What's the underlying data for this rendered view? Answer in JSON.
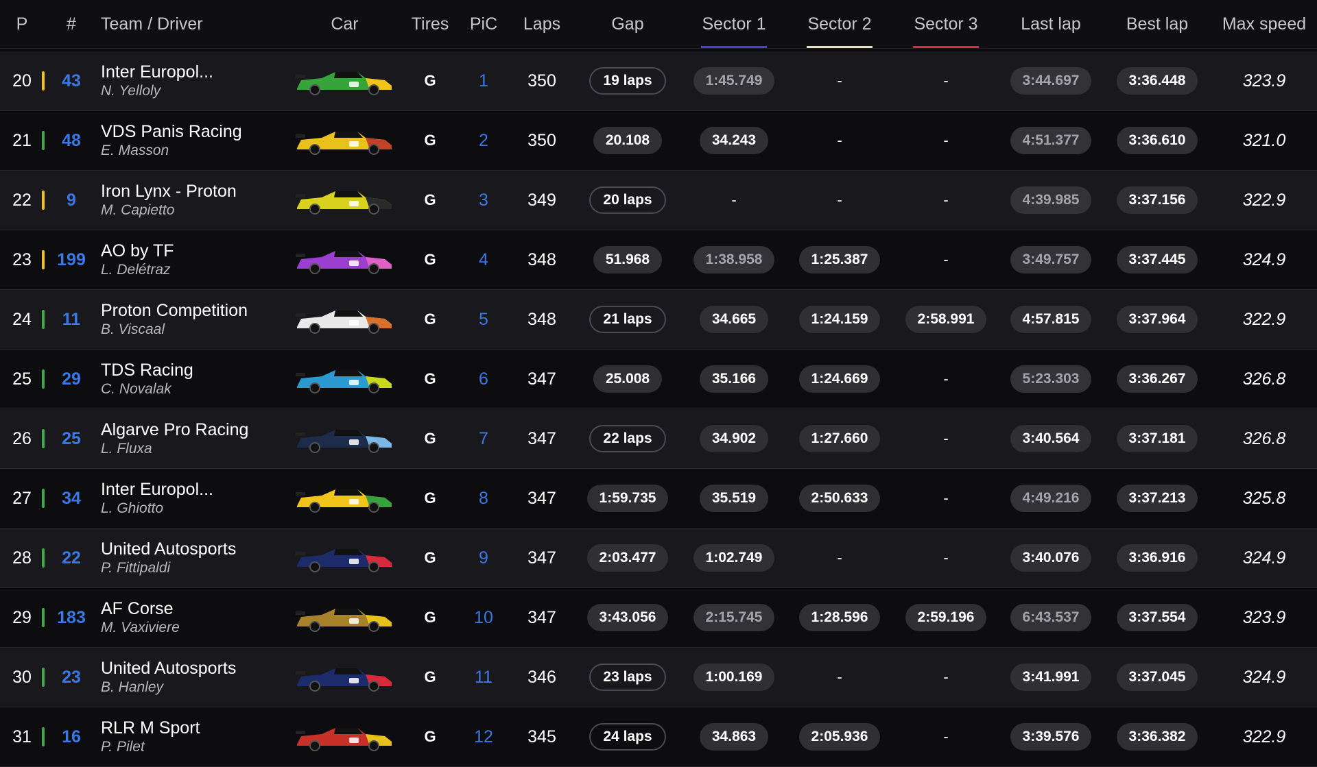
{
  "colors": {
    "accent_blue": "#3b78e7",
    "sector1": "#4a3fd8",
    "sector2": "#e8e1c8",
    "sector3": "#d62848",
    "bar_green": "#3da94a",
    "bar_yellow": "#f0c419"
  },
  "headers": {
    "pos": "P",
    "num": "#",
    "team": "Team / Driver",
    "car": "Car",
    "tires": "Tires",
    "pic": "PiC",
    "laps": "Laps",
    "gap": "Gap",
    "s1": "Sector 1",
    "s2": "Sector 2",
    "s3": "Sector 3",
    "last": "Last lap",
    "best": "Best lap",
    "speed": "Max speed"
  },
  "rows": [
    {
      "pos": "20",
      "bar": "yellow",
      "num": "43",
      "team": "Inter Europol...",
      "driver": "N. Yelloly",
      "tire": "G",
      "pic": "1",
      "laps": "350",
      "gap": "19 laps",
      "gap_style": "outline",
      "s1": "1:45.749",
      "s1_dim": true,
      "s2": "-",
      "s3": "-",
      "last": "3:44.697",
      "last_dim": true,
      "best": "3:36.448",
      "speed": "323.9",
      "livery": [
        "#36a33b",
        "#f0c419"
      ]
    },
    {
      "pos": "21",
      "bar": "green",
      "num": "48",
      "team": "VDS Panis Racing",
      "driver": "E. Masson",
      "tire": "G",
      "pic": "2",
      "laps": "350",
      "gap": "20.108",
      "gap_style": "fill",
      "s1": "34.243",
      "s1_dim": false,
      "s2": "-",
      "s3": "-",
      "last": "4:51.377",
      "last_dim": true,
      "best": "3:36.610",
      "speed": "321.0",
      "livery": [
        "#e8c21a",
        "#c2432a"
      ]
    },
    {
      "pos": "22",
      "bar": "yellow",
      "num": "9",
      "team": "Iron Lynx - Proton",
      "driver": "M. Capietto",
      "tire": "G",
      "pic": "3",
      "laps": "349",
      "gap": "20 laps",
      "gap_style": "outline",
      "s1": "-",
      "s1_dim": false,
      "s2": "-",
      "s3": "-",
      "last": "4:39.985",
      "last_dim": true,
      "best": "3:37.156",
      "speed": "322.9",
      "livery": [
        "#d8d21e",
        "#2a2a2a"
      ]
    },
    {
      "pos": "23",
      "bar": "yellow",
      "num": "199",
      "team": "AO by TF",
      "driver": "L. Delétraz",
      "tire": "G",
      "pic": "4",
      "laps": "348",
      "gap": "51.968",
      "gap_style": "fill",
      "s1": "1:38.958",
      "s1_dim": true,
      "s2": "1:25.387",
      "s2_dim": false,
      "s3": "-",
      "last": "3:49.757",
      "last_dim": true,
      "best": "3:37.445",
      "speed": "324.9",
      "livery": [
        "#9b3fd0",
        "#e060c8"
      ]
    },
    {
      "pos": "24",
      "bar": "green",
      "num": "11",
      "team": "Proton Competition",
      "driver": "B. Viscaal",
      "tire": "G",
      "pic": "5",
      "laps": "348",
      "gap": "21 laps",
      "gap_style": "outline",
      "s1": "34.665",
      "s1_dim": false,
      "s2": "1:24.159",
      "s2_dim": false,
      "s3": "2:58.991",
      "s3_dim": false,
      "last": "4:57.815",
      "last_dim": false,
      "best": "3:37.964",
      "speed": "322.9",
      "livery": [
        "#e8e8e8",
        "#d8702a"
      ]
    },
    {
      "pos": "25",
      "bar": "green",
      "num": "29",
      "team": "TDS Racing",
      "driver": "C. Novalak",
      "tire": "G",
      "pic": "6",
      "laps": "347",
      "gap": "25.008",
      "gap_style": "fill",
      "s1": "35.166",
      "s1_dim": false,
      "s2": "1:24.669",
      "s2_dim": false,
      "s3": "-",
      "last": "5:23.303",
      "last_dim": true,
      "best": "3:36.267",
      "speed": "326.8",
      "livery": [
        "#2a9ad0",
        "#c8d81e"
      ]
    },
    {
      "pos": "26",
      "bar": "green",
      "num": "25",
      "team": "Algarve Pro Racing",
      "driver": "L. Fluxa",
      "tire": "G",
      "pic": "7",
      "laps": "347",
      "gap": "22 laps",
      "gap_style": "outline",
      "s1": "34.902",
      "s1_dim": false,
      "s2": "1:27.660",
      "s2_dim": false,
      "s3": "-",
      "last": "3:40.564",
      "last_dim": false,
      "best": "3:37.181",
      "speed": "326.8",
      "livery": [
        "#1c2c4a",
        "#7ab8e8"
      ]
    },
    {
      "pos": "27",
      "bar": "green",
      "num": "34",
      "team": "Inter Europol...",
      "driver": "L. Ghiotto",
      "tire": "G",
      "pic": "8",
      "laps": "347",
      "gap": "1:59.735",
      "gap_style": "fill",
      "s1": "35.519",
      "s1_dim": false,
      "s2": "2:50.633",
      "s2_dim": false,
      "s3": "-",
      "last": "4:49.216",
      "last_dim": true,
      "best": "3:37.213",
      "speed": "325.8",
      "livery": [
        "#f0c419",
        "#36a33b"
      ]
    },
    {
      "pos": "28",
      "bar": "green",
      "num": "22",
      "team": "United Autosports",
      "driver": "P. Fittipaldi",
      "tire": "G",
      "pic": "9",
      "laps": "347",
      "gap": "2:03.477",
      "gap_style": "fill",
      "s1": "1:02.749",
      "s1_dim": false,
      "s2": "-",
      "s3": "-",
      "last": "3:40.076",
      "last_dim": false,
      "best": "3:36.916",
      "speed": "324.9",
      "livery": [
        "#1c2c6a",
        "#d82a3a"
      ]
    },
    {
      "pos": "29",
      "bar": "green",
      "num": "183",
      "team": "AF Corse",
      "driver": "M. Vaxiviere",
      "tire": "G",
      "pic": "10",
      "laps": "347",
      "gap": "3:43.056",
      "gap_style": "fill",
      "s1": "2:15.745",
      "s1_dim": true,
      "s2": "1:28.596",
      "s2_dim": false,
      "s3": "2:59.196",
      "s3_dim": false,
      "last": "6:43.537",
      "last_dim": true,
      "best": "3:37.554",
      "speed": "323.9",
      "livery": [
        "#a8822a",
        "#e8c21a"
      ]
    },
    {
      "pos": "30",
      "bar": "green",
      "num": "23",
      "team": "United Autosports",
      "driver": "B. Hanley",
      "tire": "G",
      "pic": "11",
      "laps": "346",
      "gap": "23 laps",
      "gap_style": "outline",
      "s1": "1:00.169",
      "s1_dim": false,
      "s2": "-",
      "s3": "-",
      "last": "3:41.991",
      "last_dim": false,
      "best": "3:37.045",
      "speed": "324.9",
      "livery": [
        "#1c2c6a",
        "#d82a3a"
      ]
    },
    {
      "pos": "31",
      "bar": "green",
      "num": "16",
      "team": "RLR M Sport",
      "driver": "P. Pilet",
      "tire": "G",
      "pic": "12",
      "laps": "345",
      "gap": "24 laps",
      "gap_style": "outline",
      "s1": "34.863",
      "s1_dim": false,
      "s2": "2:05.936",
      "s2_dim": false,
      "s3": "-",
      "last": "3:39.576",
      "last_dim": false,
      "best": "3:36.382",
      "speed": "322.9",
      "livery": [
        "#c8302a",
        "#e8c21a"
      ]
    }
  ]
}
